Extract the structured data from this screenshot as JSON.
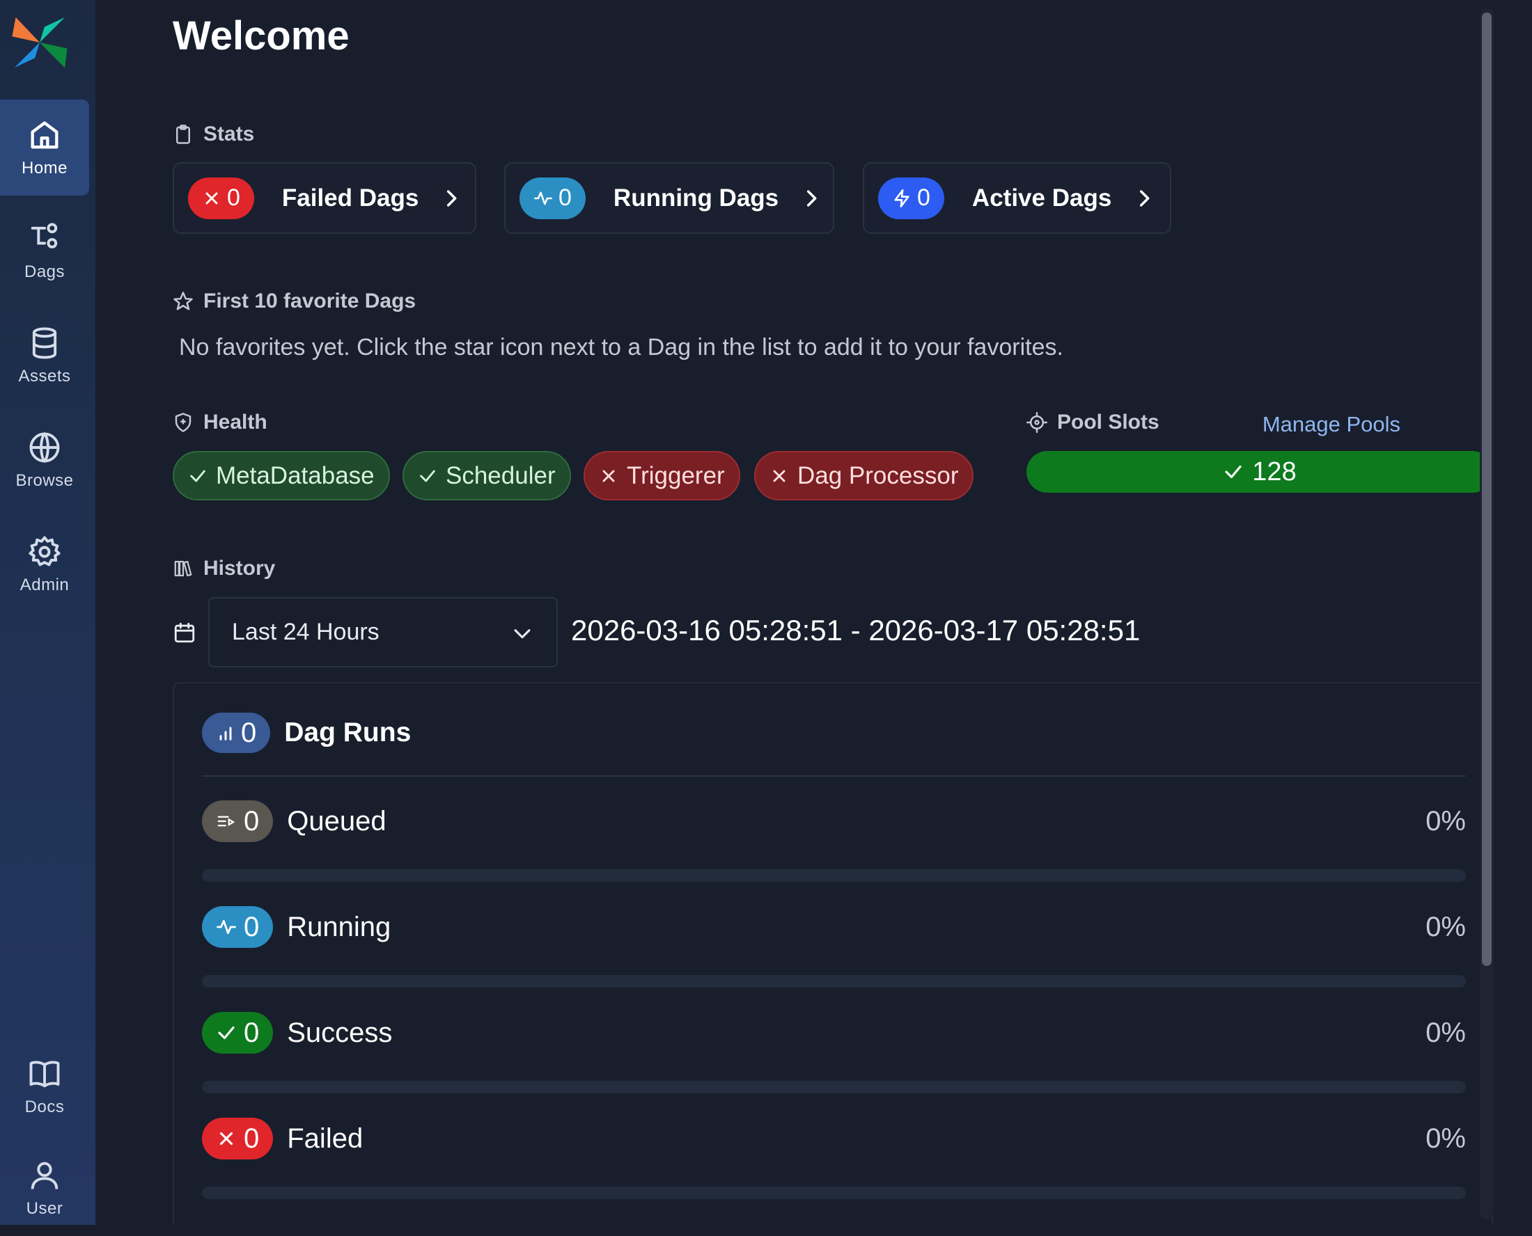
{
  "sidebar": {
    "items": [
      {
        "label": "Home",
        "icon": "home-icon",
        "active": true
      },
      {
        "label": "Dags",
        "icon": "dags-icon"
      },
      {
        "label": "Assets",
        "icon": "database-icon"
      },
      {
        "label": "Browse",
        "icon": "globe-icon"
      },
      {
        "label": "Admin",
        "icon": "gear-icon"
      },
      {
        "label": "Docs",
        "icon": "book-icon"
      },
      {
        "label": "User",
        "icon": "user-icon"
      }
    ]
  },
  "page": {
    "title": "Welcome"
  },
  "stats": {
    "heading": "Stats",
    "cards": [
      {
        "count": "0",
        "label": "Failed Dags",
        "color": "#e0262b"
      },
      {
        "count": "0",
        "label": "Running Dags",
        "color": "#2b8fc4"
      },
      {
        "count": "0",
        "label": "Active Dags",
        "color": "#2c5cf2"
      }
    ]
  },
  "favorites": {
    "heading": "First 10 favorite Dags",
    "empty_text": "No favorites yet. Click the star icon next to a Dag in the list to add it to your favorites."
  },
  "health": {
    "heading": "Health",
    "items": [
      {
        "label": "MetaDatabase",
        "status": "ok"
      },
      {
        "label": "Scheduler",
        "status": "ok"
      },
      {
        "label": "Triggerer",
        "status": "error"
      },
      {
        "label": "Dag Processor",
        "status": "error"
      }
    ]
  },
  "pool_slots": {
    "heading": "Pool Slots",
    "manage_link": "Manage Pools",
    "value": "128",
    "color": "#0d7a1e"
  },
  "history": {
    "heading": "History",
    "range_select": "Last 24 Hours",
    "date_range": "2026-03-16 05:28:51 - 2026-03-17 05:28:51"
  },
  "dag_runs": {
    "title": "Dag Runs",
    "total": "0",
    "rows": [
      {
        "label": "Queued",
        "count": "0",
        "percent_text": "0%",
        "percent": 0,
        "color": "#5a5650"
      },
      {
        "label": "Running",
        "count": "0",
        "percent_text": "0%",
        "percent": 0,
        "color": "#2b8fc4"
      },
      {
        "label": "Success",
        "count": "0",
        "percent_text": "0%",
        "percent": 0,
        "color": "#0d7a1e"
      },
      {
        "label": "Failed",
        "count": "0",
        "percent_text": "0%",
        "percent": 0,
        "color": "#e0262b"
      }
    ]
  }
}
